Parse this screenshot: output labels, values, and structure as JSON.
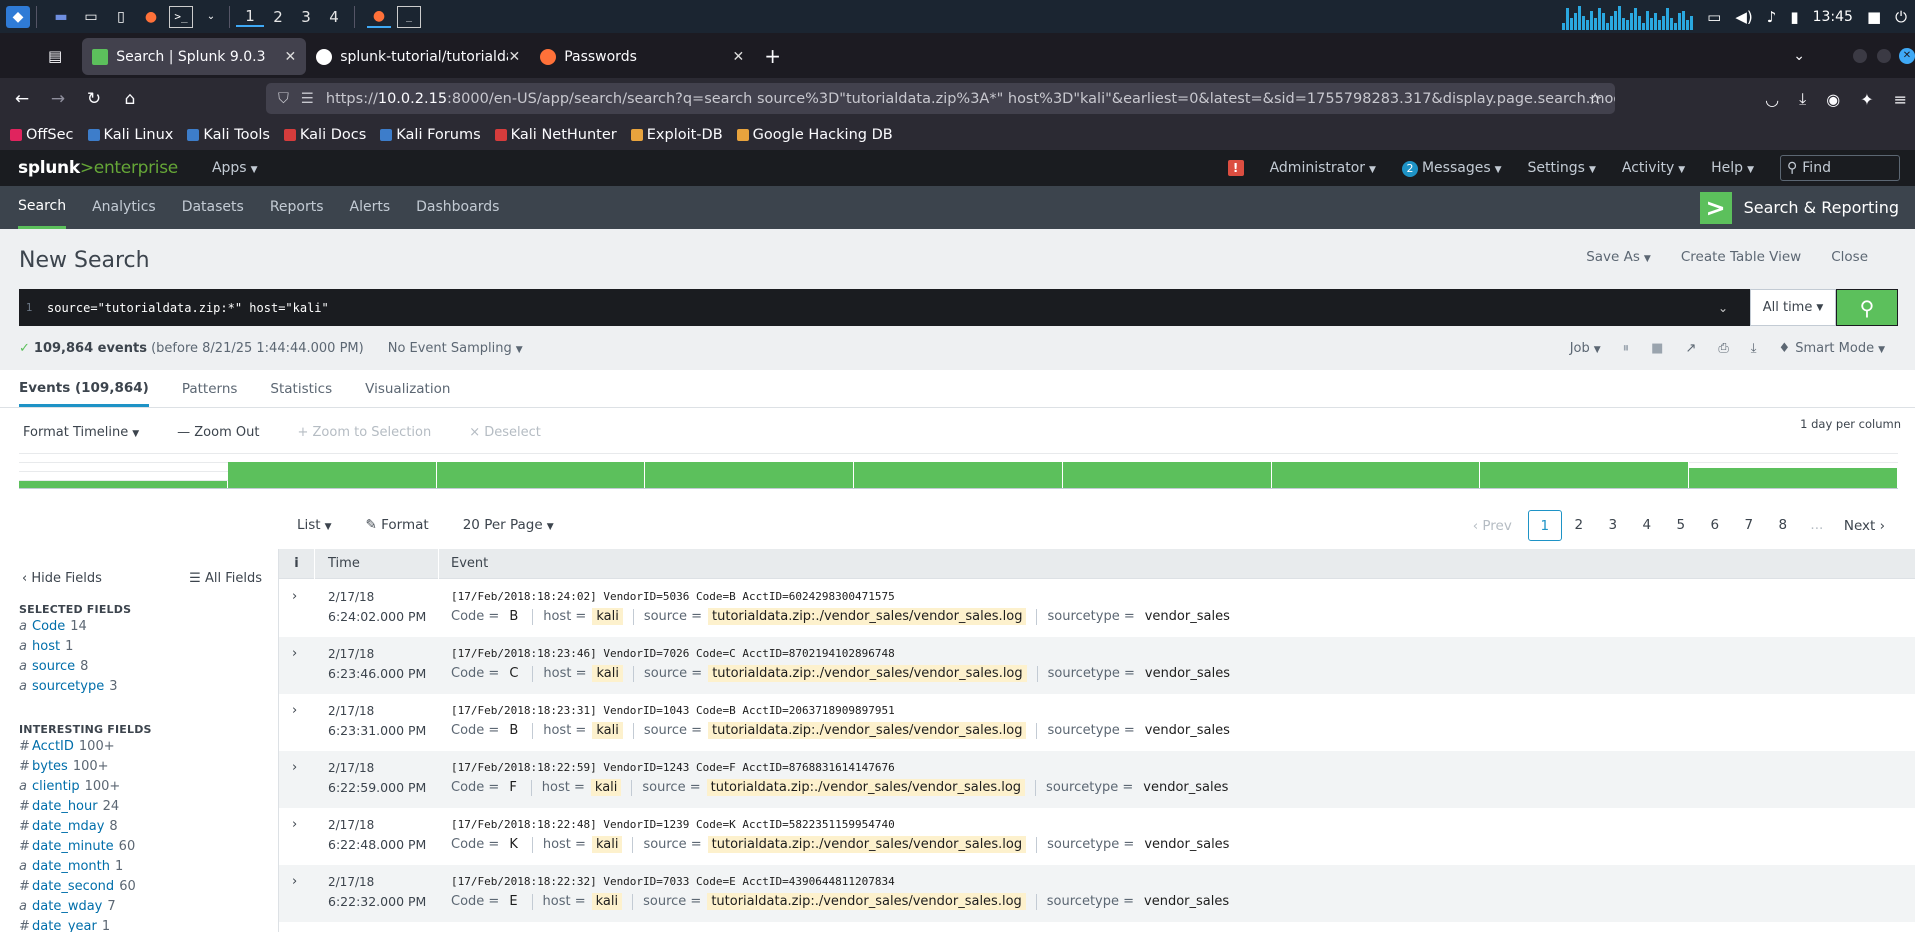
{
  "os": {
    "workspaces": [
      "1",
      "2",
      "3",
      "4"
    ],
    "clock": "13:45",
    "cpu_levels": [
      0.3,
      0.9,
      0.5,
      0.7,
      1,
      0.6,
      0.4,
      0.8,
      0.5,
      0.9,
      0.7,
      0.3,
      0.6,
      0.8,
      1,
      0.5,
      0.4,
      0.7,
      0.9,
      0.6,
      0.3,
      0.8,
      0.5,
      0.7,
      0.4,
      0.6,
      0.9,
      0.5,
      0.3,
      0.7,
      0.8,
      0.4,
      0.6
    ]
  },
  "browser": {
    "tabs": [
      {
        "title": "Search | Splunk 9.0.3",
        "active": true,
        "fav_color": "#5cc05c"
      },
      {
        "title": "splunk-tutorial/tutorialdata",
        "active": false,
        "fav_color": "#ffffff"
      },
      {
        "title": "Passwords",
        "active": false,
        "fav_color": "#ff7139"
      }
    ],
    "url_prefix": "https://",
    "url_host": "10.0.2.15",
    "url_rest": ":8000/en-US/app/search/search?q=search source%3D\"tutorialdata.zip%3A*\" host%3D\"kali\"&earliest=0&latest=&sid=1755798283.317&display.page.search.mode=sm",
    "bookmarks": [
      {
        "label": "OffSec",
        "color": "#e0245e"
      },
      {
        "label": "Kali Linux",
        "color": "#3d7dca"
      },
      {
        "label": "Kali Tools",
        "color": "#3d7dca"
      },
      {
        "label": "Kali Docs",
        "color": "#d63c3c"
      },
      {
        "label": "Kali Forums",
        "color": "#3d7dca"
      },
      {
        "label": "Kali NetHunter",
        "color": "#d63c3c"
      },
      {
        "label": "Exploit-DB",
        "color": "#e8a33d"
      },
      {
        "label": "Google Hacking DB",
        "color": "#e8a33d"
      }
    ]
  },
  "splunk": {
    "logo_main": "splunk",
    "logo_gt": ">",
    "logo_product": "enterprise",
    "apps_label": "Apps",
    "alert_icon": "!",
    "top_menu": {
      "admin": "Administrator",
      "messages_count": "2",
      "messages": "Messages",
      "settings": "Settings",
      "activity": "Activity",
      "help": "Help",
      "find_placeholder": "Find"
    },
    "app_nav": [
      "Search",
      "Analytics",
      "Datasets",
      "Reports",
      "Alerts",
      "Dashboards"
    ],
    "app_title": "Search & Reporting",
    "app_logo_glyph": ">"
  },
  "search_page": {
    "title": "New Search",
    "actions": [
      "Save As",
      "Create Table View",
      "Close"
    ],
    "line_number": "1",
    "query": "source=\"tutorialdata.zip:*\" host=\"kali\"",
    "time_range": "All time",
    "status_check": "✓",
    "events_count": "109,864 events",
    "events_before": "(before 8/21/25 1:44:44.000 PM)",
    "sampling": "No Event Sampling",
    "job_label": "Job",
    "mode_label": "Smart Mode",
    "result_tabs": [
      "Events (109,864)",
      "Patterns",
      "Statistics",
      "Visualization"
    ],
    "timeline_tools": {
      "format": "Format Timeline",
      "zoom_out": "Zoom Out",
      "zoom_sel": "Zoom to Selection",
      "deselect": "Deselect"
    },
    "timeline_scale": "1 day per column",
    "timeline_values": [
      0.25,
      1.0,
      1.0,
      1.0,
      1.0,
      1.0,
      1.0,
      1.0,
      0.75
    ],
    "list_controls": [
      "List",
      "Format",
      "20 Per Page"
    ],
    "pager": {
      "prev": "Prev",
      "pages": [
        "1",
        "2",
        "3",
        "4",
        "5",
        "6",
        "7",
        "8"
      ],
      "dots": "...",
      "next": "Next"
    },
    "fields_panel": {
      "hide": "Hide Fields",
      "all": "All Fields",
      "selected_header": "SELECTED FIELDS",
      "selected": [
        {
          "type": "a",
          "name": "Code",
          "count": "14"
        },
        {
          "type": "a",
          "name": "host",
          "count": "1"
        },
        {
          "type": "a",
          "name": "source",
          "count": "8"
        },
        {
          "type": "a",
          "name": "sourcetype",
          "count": "3"
        }
      ],
      "interesting_header": "INTERESTING FIELDS",
      "interesting": [
        {
          "type": "#",
          "name": "AcctID",
          "count": "100+"
        },
        {
          "type": "#",
          "name": "bytes",
          "count": "100+"
        },
        {
          "type": "a",
          "name": "clientip",
          "count": "100+"
        },
        {
          "type": "#",
          "name": "date_hour",
          "count": "24"
        },
        {
          "type": "#",
          "name": "date_mday",
          "count": "8"
        },
        {
          "type": "#",
          "name": "date_minute",
          "count": "60"
        },
        {
          "type": "a",
          "name": "date_month",
          "count": "1"
        },
        {
          "type": "#",
          "name": "date_second",
          "count": "60"
        },
        {
          "type": "a",
          "name": "date_wday",
          "count": "7"
        },
        {
          "type": "#",
          "name": "date_year",
          "count": "1"
        }
      ]
    },
    "table_headers": [
      "i",
      "Time",
      "Event"
    ],
    "events": [
      {
        "date": "2/17/18",
        "time": "6:24:02.000 PM",
        "raw": "[17/Feb/2018:18:24:02] VendorID=5036 Code=B AcctID=6024298300471575",
        "code": "B",
        "host": "kali",
        "source": "tutorialdata.zip:./vendor_sales/vendor_sales.log",
        "sourcetype": "vendor_sales"
      },
      {
        "date": "2/17/18",
        "time": "6:23:46.000 PM",
        "raw": "[17/Feb/2018:18:23:46] VendorID=7026 Code=C AcctID=8702194102896748",
        "code": "C",
        "host": "kali",
        "source": "tutorialdata.zip:./vendor_sales/vendor_sales.log",
        "sourcetype": "vendor_sales"
      },
      {
        "date": "2/17/18",
        "time": "6:23:31.000 PM",
        "raw": "[17/Feb/2018:18:23:31] VendorID=1043 Code=B AcctID=2063718909897951",
        "code": "B",
        "host": "kali",
        "source": "tutorialdata.zip:./vendor_sales/vendor_sales.log",
        "sourcetype": "vendor_sales"
      },
      {
        "date": "2/17/18",
        "time": "6:22:59.000 PM",
        "raw": "[17/Feb/2018:18:22:59] VendorID=1243 Code=F AcctID=8768831614147676",
        "code": "F",
        "host": "kali",
        "source": "tutorialdata.zip:./vendor_sales/vendor_sales.log",
        "sourcetype": "vendor_sales"
      },
      {
        "date": "2/17/18",
        "time": "6:22:48.000 PM",
        "raw": "[17/Feb/2018:18:22:48] VendorID=1239 Code=K AcctID=5822351159954740",
        "code": "K",
        "host": "kali",
        "source": "tutorialdata.zip:./vendor_sales/vendor_sales.log",
        "sourcetype": "vendor_sales"
      },
      {
        "date": "2/17/18",
        "time": "6:22:32.000 PM",
        "raw": "[17/Feb/2018:18:22:32] VendorID=7033 Code=E AcctID=4390644811207834",
        "code": "E",
        "host": "kali",
        "source": "tutorialdata.zip:./vendor_sales/vendor_sales.log",
        "sourcetype": "vendor_sales"
      }
    ],
    "kv_labels": {
      "code": "Code =",
      "host": "host =",
      "source": "source =",
      "sourcetype": "sourcetype ="
    }
  }
}
